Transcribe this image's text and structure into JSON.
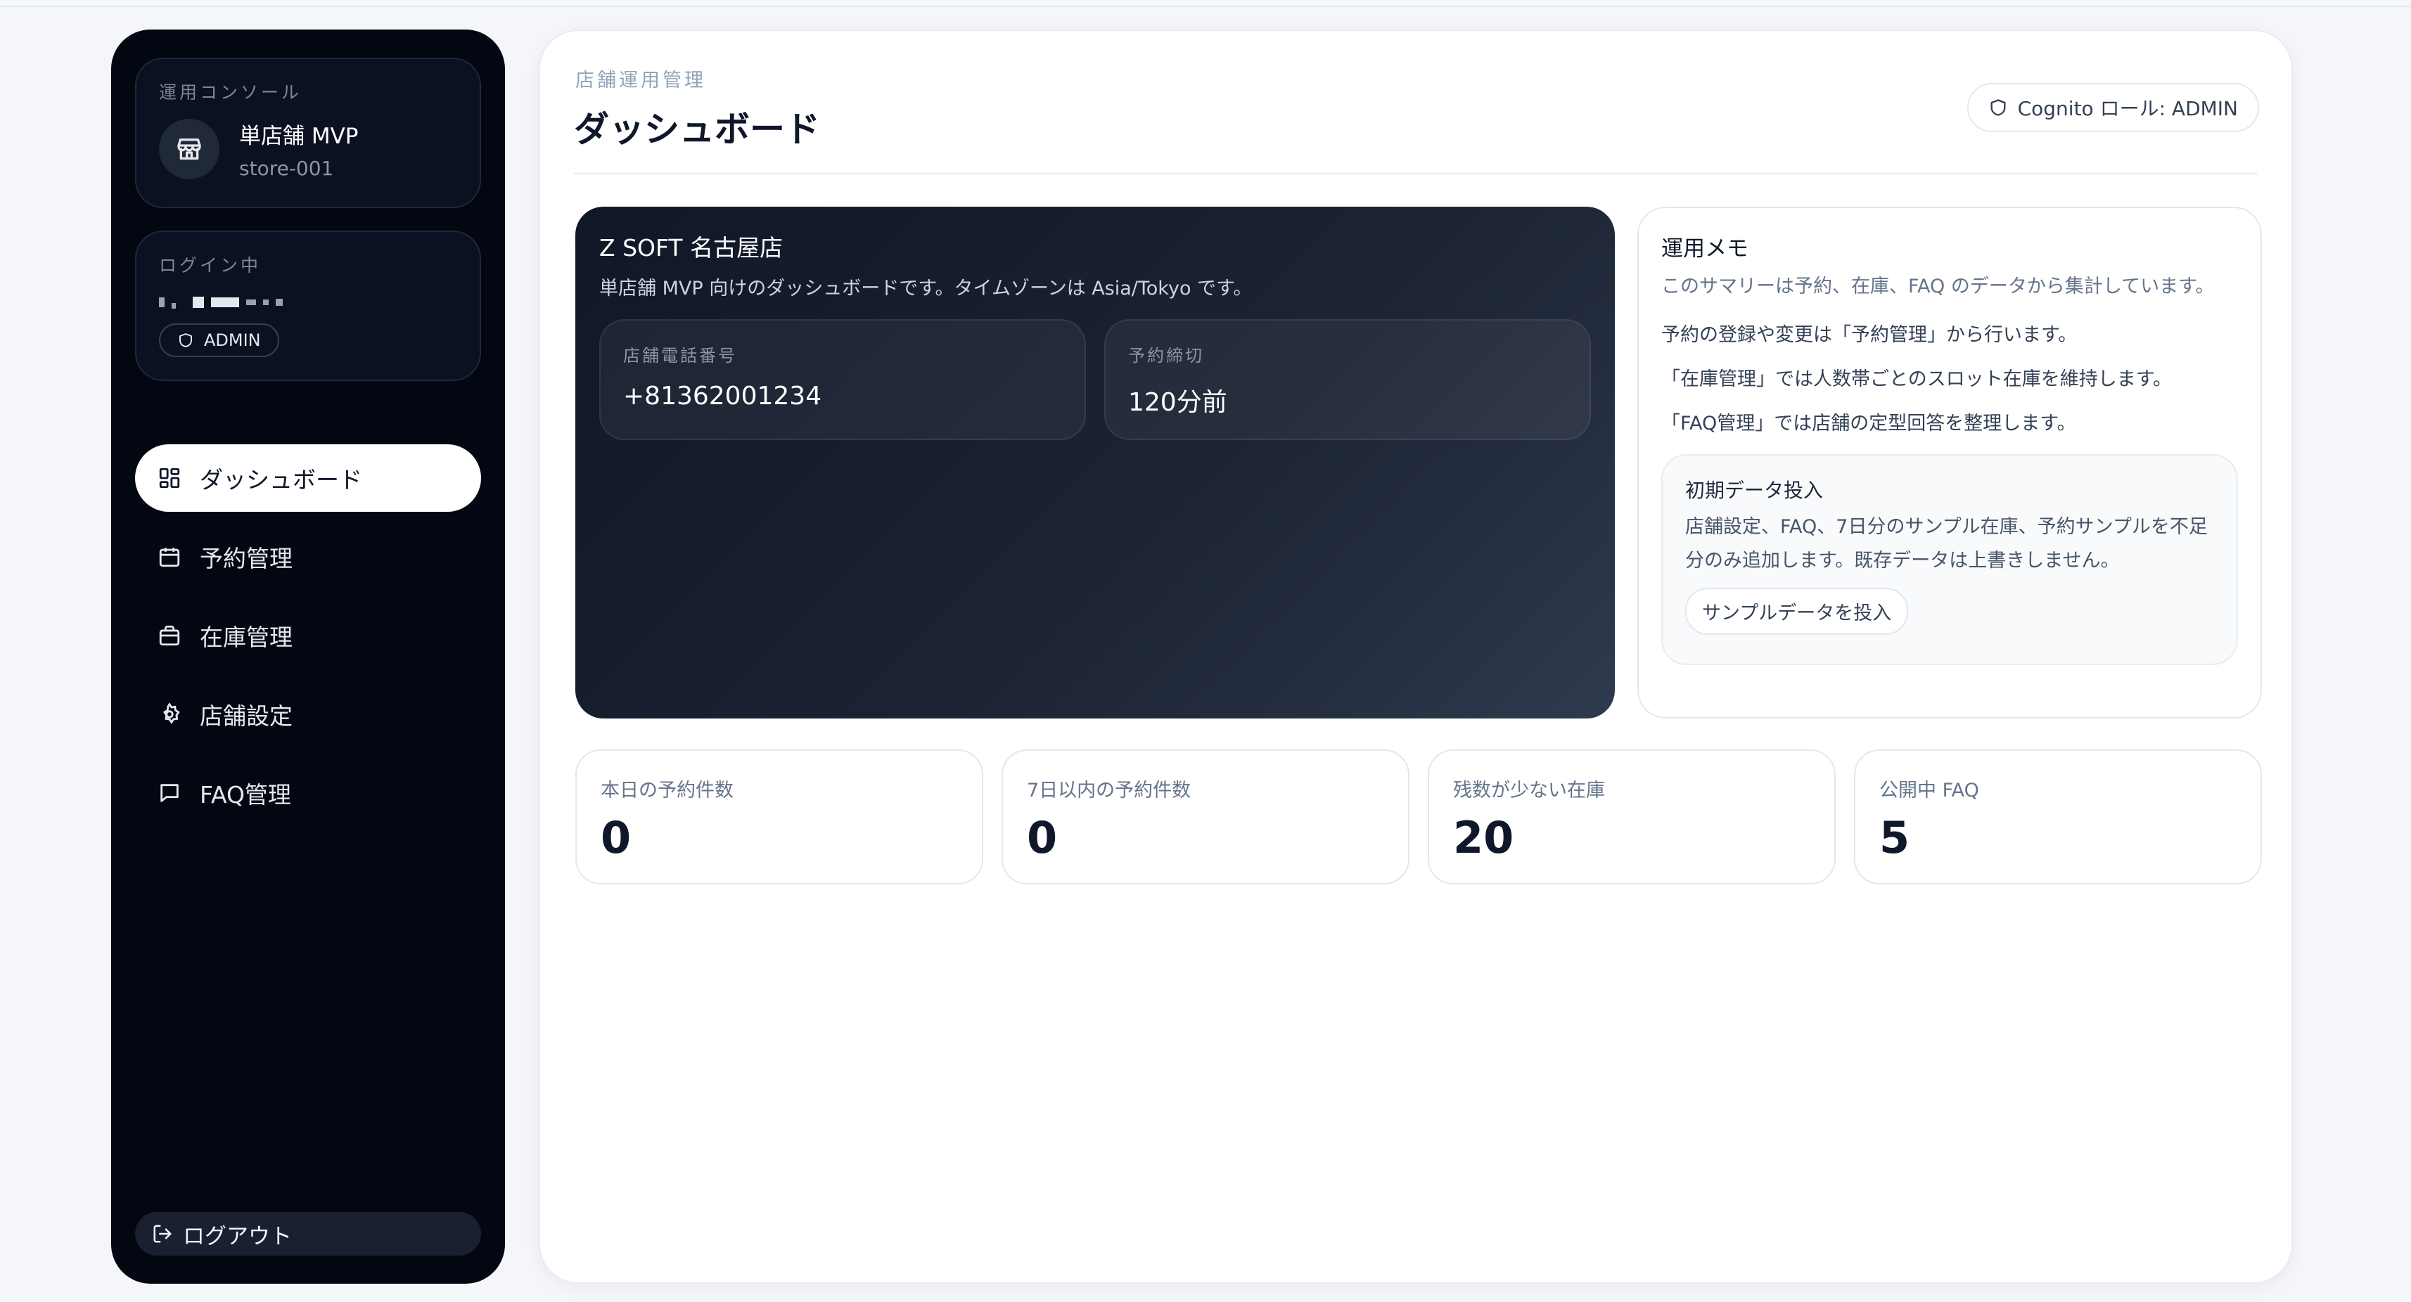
{
  "sidebar": {
    "console_caption": "運用コンソール",
    "brand_name": "単店舗 MVP",
    "store_id": "store-001",
    "login_caption": "ログイン中",
    "role_chip": "ADMIN",
    "nav": [
      {
        "label": "ダッシュボード",
        "icon": "dashboard-icon",
        "active": true
      },
      {
        "label": "予約管理",
        "icon": "calendar-icon",
        "active": false
      },
      {
        "label": "在庫管理",
        "icon": "inventory-icon",
        "active": false
      },
      {
        "label": "店舗設定",
        "icon": "gear-icon",
        "active": false
      },
      {
        "label": "FAQ管理",
        "icon": "message-icon",
        "active": false
      }
    ],
    "logout_label": "ログアウト"
  },
  "header": {
    "eyebrow": "店舗運用管理",
    "title": "ダッシュボード",
    "role_badge": "Cognito ロール: ADMIN"
  },
  "store": {
    "name": "Z SOFT 名古屋店",
    "description": "単店舗 MVP 向けのダッシュボードです。タイムゾーンは Asia/Tokyo です。",
    "phone_label": "店舗電話番号",
    "phone_value": "+81362001234",
    "cutoff_label": "予約締切",
    "cutoff_value": "120分前"
  },
  "memo": {
    "title": "運用メモ",
    "subtitle": "このサマリーは予約、在庫、FAQ のデータから集計しています。",
    "lines": [
      "予約の登録や変更は「予約管理」から行います。",
      "「在庫管理」では人数帯ごとのスロット在庫を維持します。",
      "「FAQ管理」では店舗の定型回答を整理します。"
    ],
    "init": {
      "title": "初期データ投入",
      "description": "店舗設定、FAQ、7日分のサンプル在庫、予約サンプルを不足分のみ追加します。既存データは上書きしません。",
      "button": "サンプルデータを投入"
    }
  },
  "kpis": [
    {
      "label": "本日の予約件数",
      "value": "0"
    },
    {
      "label": "7日以内の予約件数",
      "value": "0"
    },
    {
      "label": "残数が少ない在庫",
      "value": "20"
    },
    {
      "label": "公開中 FAQ",
      "value": "5"
    }
  ],
  "colors": {
    "sidebar_bg": "#030712",
    "store_card_bg": "#1c2435",
    "page_bg": "#f4f6f9"
  }
}
